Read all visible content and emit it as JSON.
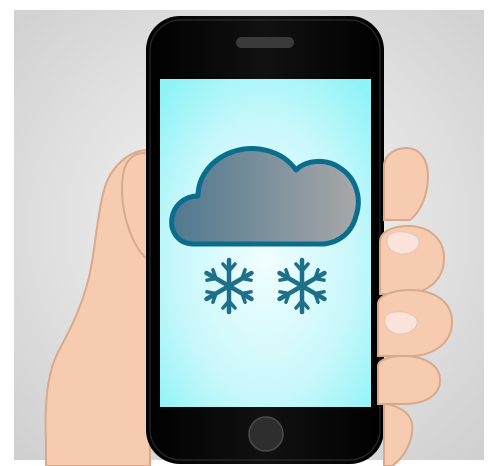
{
  "scene": {
    "subject": "hand-holding-smartphone",
    "screen_content": "weather-snow-icon",
    "icons": [
      "cloud-icon",
      "snowflake-icon",
      "snowflake-icon"
    ]
  },
  "colors": {
    "background_outer": "#d4d4d4",
    "background_inner": "#f7f7f7",
    "skin": "#f7cbb0",
    "skin_outline": "#d9a98c",
    "phone_body": "#050505",
    "screen_edge": "#8ff3f7",
    "screen_center": "#eefcff",
    "cloud_fill_left": "#4f7890",
    "cloud_fill_right": "#a4a4a4",
    "cloud_outline": "#0b6d8d",
    "snowflake": "#1e6f8a",
    "speaker": "#3a3a3a",
    "home_button": "#2e2e2e",
    "fingernail": "#fbe3dc"
  }
}
